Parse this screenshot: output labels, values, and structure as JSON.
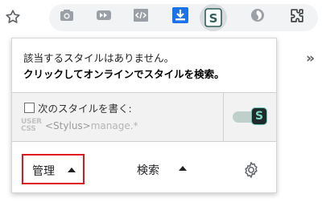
{
  "toolbar": {
    "extensions": [
      {
        "name": "camera-icon",
        "color": "#9aa0a6"
      },
      {
        "name": "fast-forward-icon",
        "color": "#9aa0a6"
      },
      {
        "name": "code-icon",
        "color": "#9aa0a6"
      },
      {
        "name": "download-icon",
        "color": "#1a73e8"
      },
      {
        "name": "stylus-icon",
        "color": "#2f5f5a",
        "active": true
      },
      {
        "name": "circle-logo-icon",
        "color": "#9aa0a6"
      },
      {
        "name": "puzzle-icon",
        "color": "#3c4043"
      }
    ],
    "stylus_letter": "S",
    "overflow_chevron": "»"
  },
  "popup": {
    "message_line1": "該当するスタイルはありません。",
    "message_line2": "クリックしてオンラインでスタイルを検索。",
    "write_style": {
      "label": "次のスタイルを書く:",
      "usercss_label": "USER CSS",
      "usercss_line1": "USER",
      "usercss_line2": "CSS",
      "target_prefix": "<Stylus>",
      "target_suffix": "manage.*",
      "toggle_on": true,
      "toggle_letter": "S"
    },
    "footer": {
      "manage_label": "管理",
      "search_label": "検索"
    }
  },
  "colors": {
    "highlight_border": "#e0161b",
    "stylus_accent": "#69c2b2"
  }
}
